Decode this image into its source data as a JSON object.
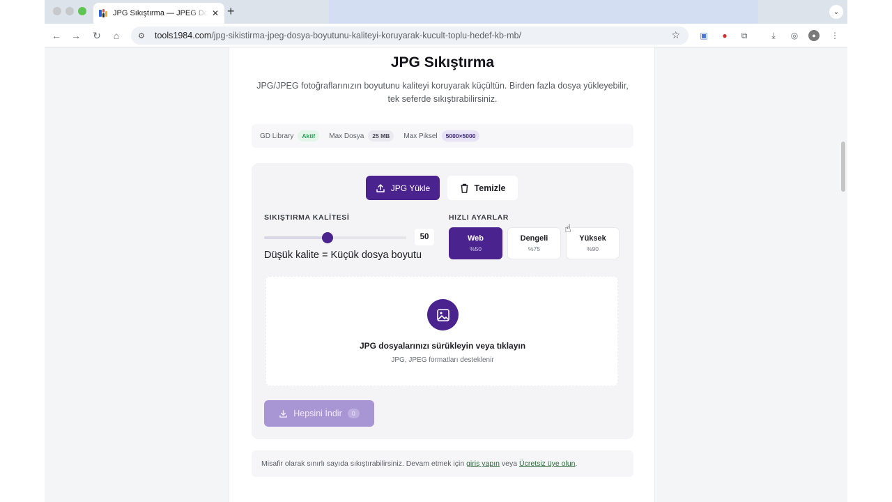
{
  "browser": {
    "tab_title": "JPG Sıkıştırma — JPEG Dosya",
    "url_domain": "tools1984.com",
    "url_path": "/jpg-sikistirma-jpeg-dosya-boyutunu-kaliteyi-koruyarak-kucult-toplu-hedef-kb-mb/",
    "accent": "#4b238f"
  },
  "page": {
    "title": "JPG Sıkıştırma",
    "subtitle": "JPG/JPEG fotoğraflarınızın boyutunu kaliteyi koruyarak küçültün. Birden fazla dosya yükleyebilir, tek seferde sıkıştırabilirsiniz."
  },
  "info": {
    "library_label": "GD Library",
    "library_badge": "Aktif",
    "max_file_label": "Max Dosya",
    "max_file_value": "25 MB",
    "max_pixel_label": "Max Piksel",
    "max_pixel_value": "5000×5000"
  },
  "actions": {
    "upload_label": "JPG Yükle",
    "clear_label": "Temizle"
  },
  "quality": {
    "label": "SIKIŞTIRMA KALİTESİ",
    "value": "50",
    "value_percent": 50,
    "hint": "Düşük kalite = Küçük dosya boyutu"
  },
  "presets": {
    "label": "HIZLI AYARLAR",
    "items": [
      {
        "name": "Web",
        "percent": "%50"
      },
      {
        "name": "Dengeli",
        "percent": "%75"
      },
      {
        "name": "Yüksek",
        "percent": "%90"
      }
    ],
    "active_index": 0
  },
  "dropzone": {
    "title": "JPG dosyalarınızı sürükleyin veya tıklayın",
    "subtitle": "JPG, JPEG formatları desteklenir"
  },
  "download": {
    "label": "Hepsini İndir",
    "count": "0"
  },
  "footer": {
    "text_before": "Misafir olarak sınırlı sayıda sıkıştırabilirsiniz. Devam etmek için",
    "login_link": "giriş yapın",
    "text_middle": "veya",
    "signup_link": "Ücretsiz üye olun",
    "text_after": "."
  }
}
